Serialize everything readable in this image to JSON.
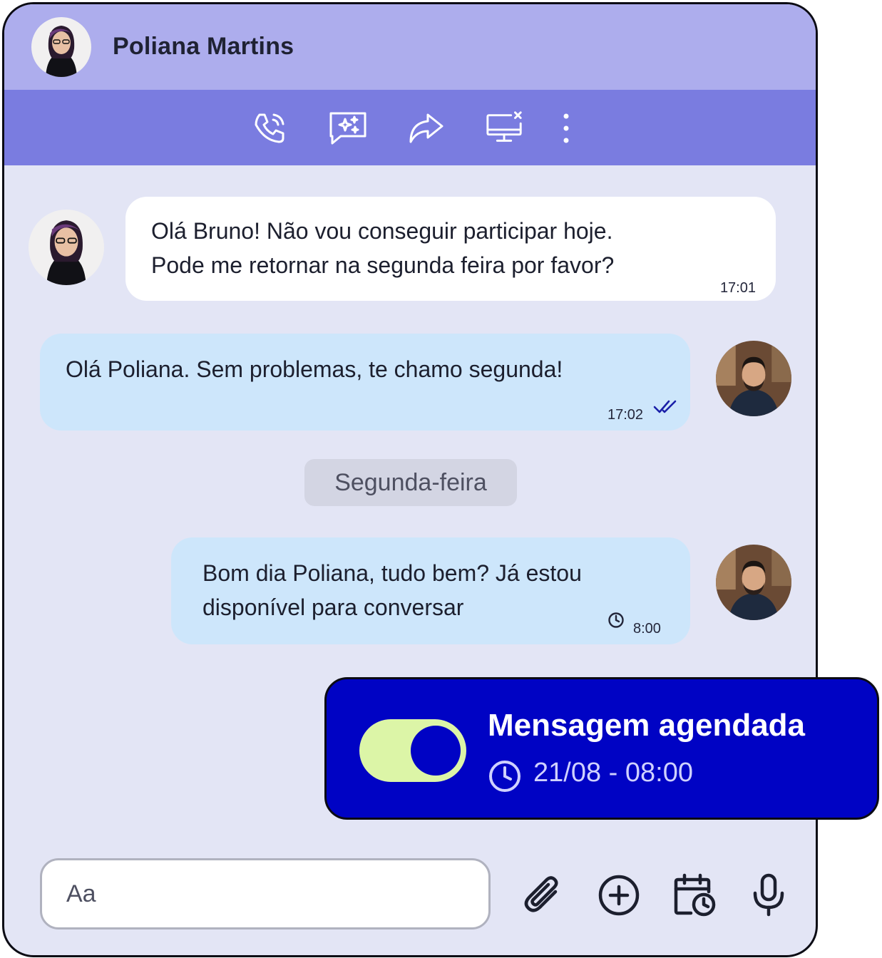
{
  "header": {
    "contact_name": "Poliana Martins"
  },
  "toolbar": {
    "icons": [
      "phone-call-icon",
      "ai-chat-icon",
      "forward-icon",
      "screen-share-off-icon",
      "more-vertical-icon"
    ]
  },
  "messages": [
    {
      "direction": "incoming",
      "text": "Olá Bruno! Não vou conseguir participar hoje.\nPode me retornar na segunda feira por favor?",
      "time": "17:01"
    },
    {
      "direction": "outgoing",
      "text": "Olá Poliana. Sem problemas, te chamo segunda!",
      "time": "17:02",
      "status": "read-double-check"
    },
    {
      "direction": "outgoing",
      "text": "Bom dia Poliana, tudo bem? Já estou\ndisponível para conversar",
      "time": "8:00",
      "status": "scheduled-clock"
    }
  ],
  "day_separator": "Segunda-feira",
  "scheduled": {
    "title": "Mensagem agendada",
    "datetime": "21/08 - 08:00",
    "enabled": true
  },
  "composer": {
    "placeholder": "Aa",
    "icons": [
      "paperclip-icon",
      "add-circle-icon",
      "calendar-clock-icon",
      "microphone-icon"
    ]
  },
  "colors": {
    "header": "#adaded",
    "toolbar": "#7a7ce0",
    "chat_bg": "#e3e5f5",
    "outgoing_bubble": "#cde6fb",
    "incoming_bubble": "#ffffff",
    "schedule_card": "#0003c4",
    "toggle_on": "#dcf5a7"
  }
}
